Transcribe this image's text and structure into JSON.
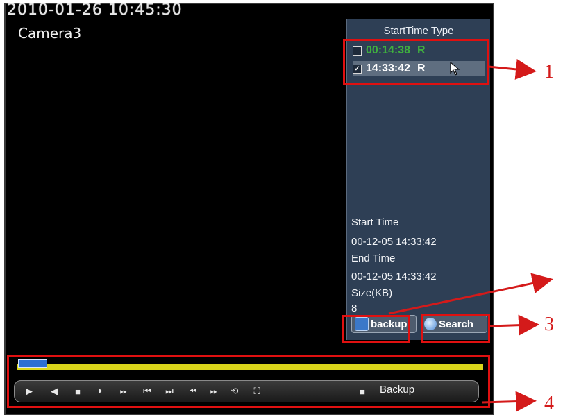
{
  "osd": {
    "datetime": "2010-01-26 10:45:30",
    "camera": "Camera3"
  },
  "file_list": {
    "header": "StartTime Type",
    "rows": [
      {
        "time": "00:14:38",
        "type": "R",
        "checked": false,
        "color": "#3fae3f"
      },
      {
        "time": "14:33:42",
        "type": "R",
        "checked": true,
        "color": "#ffffff"
      }
    ]
  },
  "file_info": {
    "start_label": "Start Time",
    "start_value": "00-12-05 14:33:42",
    "end_label": "End Time",
    "end_value": "00-12-05 14:33:42",
    "size_label": "Size(KB)",
    "size_value": "8"
  },
  "buttons": {
    "backup": "backup",
    "search": "Search"
  },
  "controls": {
    "backup_label": "Backup"
  },
  "callout_numbers": [
    "1",
    "3",
    "4"
  ],
  "colors": {
    "panel": "#2e3f55",
    "progress": "#d9d51a",
    "callout": "#e01010"
  }
}
